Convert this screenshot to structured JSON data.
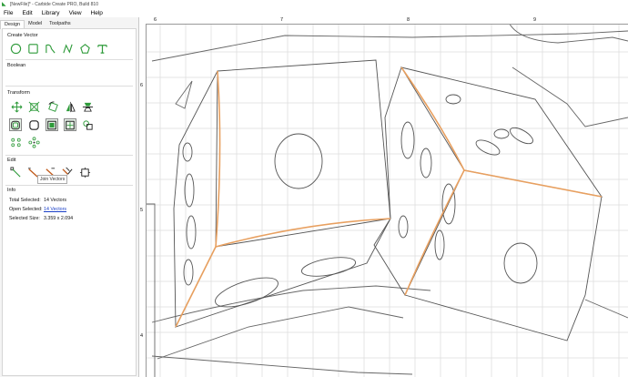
{
  "window": {
    "title": "[NewFile]* - Carbide Create PRO, Build 810",
    "app_icon": "carbide-logo-icon"
  },
  "menu": {
    "items": [
      {
        "label": "File"
      },
      {
        "label": "Edit"
      },
      {
        "label": "Library"
      },
      {
        "label": "View"
      },
      {
        "label": "Help"
      }
    ]
  },
  "sidebar": {
    "tabs": [
      {
        "label": "Design",
        "active": true
      },
      {
        "label": "Model",
        "active": false
      },
      {
        "label": "Toolpaths",
        "active": false
      }
    ],
    "sections": {
      "create_vector": "Create Vector",
      "boolean": "Boolean",
      "transform": "Transform",
      "edit": "Edit",
      "info": "Info"
    },
    "create_tools": [
      {
        "icon": "circle-tool-icon"
      },
      {
        "icon": "rectangle-tool-icon"
      },
      {
        "icon": "curve-tool-icon"
      },
      {
        "icon": "polyline-tool-icon"
      },
      {
        "icon": "polygon-tool-icon"
      },
      {
        "icon": "text-tool-icon"
      }
    ],
    "transform_tools": [
      {
        "icon": "move-icon"
      },
      {
        "icon": "scale-icon"
      },
      {
        "icon": "rotate-icon"
      },
      {
        "icon": "mirror-icon"
      },
      {
        "icon": "align-icon"
      },
      {
        "icon": "offset-icon"
      },
      {
        "icon": "fillet-icon"
      },
      {
        "icon": "group-icon"
      },
      {
        "icon": "center-icon"
      },
      {
        "icon": "array-icon"
      },
      {
        "icon": "circular-array-icon"
      }
    ],
    "edit_tools": [
      {
        "icon": "node-edit-icon"
      },
      {
        "icon": "trim-icon"
      },
      {
        "icon": "extend-icon"
      },
      {
        "icon": "join-vectors-icon"
      },
      {
        "icon": "close-vector-icon"
      }
    ],
    "tooltip": "Join Vectors",
    "info": {
      "total_selected_label": "Total Selected:",
      "total_selected_value": "14 Vectors",
      "open_selected_label": "Open Selected:",
      "open_selected_value": "14 Vectors",
      "selected_size_label": "Selected Size:",
      "selected_size_value": "3.359 x 2.094"
    }
  },
  "canvas": {
    "ruler_top_labels": [
      "6",
      "7",
      "8",
      "9"
    ],
    "ruler_left_labels": [
      "6",
      "5",
      "4"
    ],
    "colors": {
      "grid": "#d9d9d9",
      "vector": "#555555",
      "selected": "#e8a060",
      "accent": "#2e9b3a",
      "marker": "#d33333"
    }
  }
}
